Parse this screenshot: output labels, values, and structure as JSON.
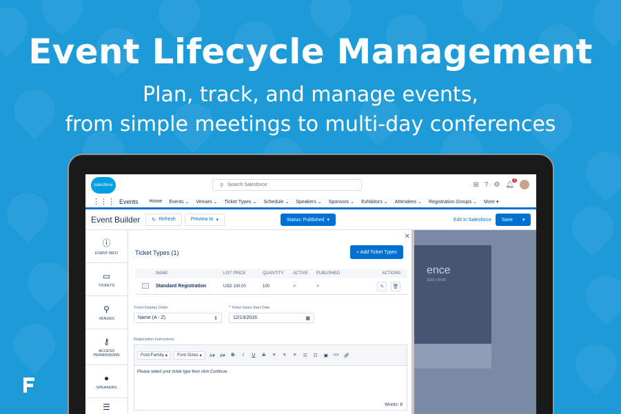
{
  "hero": {
    "title": "Event Lifecycle Management",
    "subtitle_line1": "Plan, track, and manage events,",
    "subtitle_line2": "from simple meetings to multi-day conferences"
  },
  "global_header": {
    "logo_text": "salesforce",
    "search_placeholder": "Search Salesforce",
    "notification_count": "3"
  },
  "navbar": {
    "app_name": "Events",
    "items": [
      "Home",
      "Events ⌄",
      "Venues ⌄",
      "Ticket Types ⌄",
      "Schedule ⌄",
      "Speakers ⌄",
      "Sponsors ⌄",
      "Exhibitors ⌄",
      "Attendees ⌄",
      "Registration Groups ⌄",
      "More ▾"
    ]
  },
  "builder_bar": {
    "title": "Event Builder",
    "refresh_label": "Refresh",
    "preview_label": "Preview In",
    "status_label": "Status: Published",
    "edit_link": "Edit In Salesforce",
    "save_label": "Save"
  },
  "left_nav": {
    "items": [
      "EVENT INFO",
      "TICKETS",
      "VENUES",
      "ACCESS PERMISSIONS",
      "SPEAKERS"
    ]
  },
  "ticket_types": {
    "title": "Ticket Types (1)",
    "add_button": "+ Add Ticket Types",
    "columns": {
      "name": "NAME",
      "price": "LIST PRICE",
      "qty": "QUANTITY",
      "active": "ACTIVE",
      "published": "PUBLISHED",
      "actions": "ACTIONS"
    },
    "rows": [
      {
        "name": "Standard Registration",
        "price": "USD 100.00",
        "qty": "100",
        "active": "✓",
        "published": "✓"
      }
    ]
  },
  "form": {
    "display_order_label": "Ticket Display Order",
    "display_order_value": "Name (A - Z)",
    "start_date_label": "Ticket Sales Start Date",
    "start_date_required": "*",
    "start_date_value": "12/13/2016",
    "reg_instructions_label": "Registration Instructions"
  },
  "rte": {
    "font_family": "Font Family",
    "font_sizes": "Font Sizes",
    "content": "Please select your ticket type then click Continue.",
    "word_count": "Words: 8"
  },
  "preview": {
    "word": "ence",
    "sub": "2016 | 09:00"
  },
  "colors": {
    "background": "#1d9ad8",
    "brand": "#0070d2"
  }
}
